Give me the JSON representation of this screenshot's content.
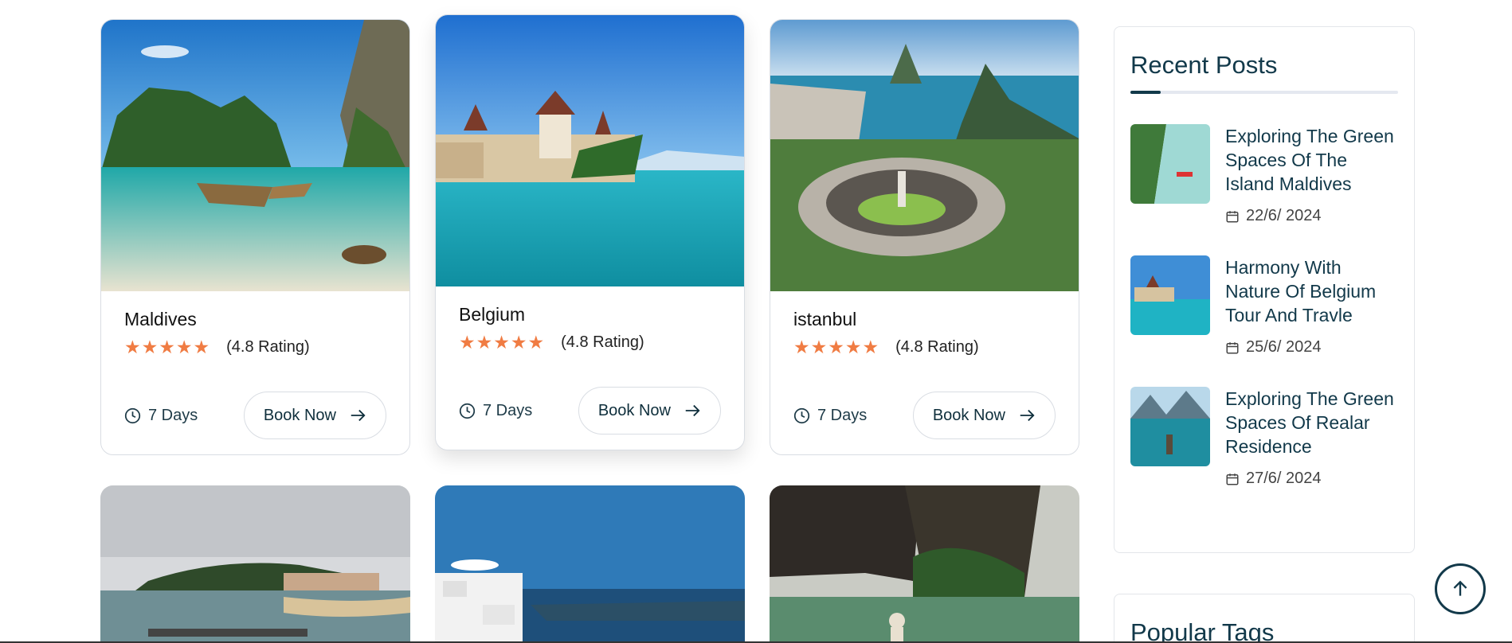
{
  "tours": [
    {
      "name": "Maldives",
      "stars": "★★★★★",
      "rating": "(4.8 Rating)",
      "days": "7 Days",
      "book": "Book Now"
    },
    {
      "name": "Belgium",
      "stars": "★★★★★",
      "rating": "(4.8 Rating)",
      "days": "7 Days",
      "book": "Book Now"
    },
    {
      "name": "istanbul",
      "stars": "★★★★★",
      "rating": "(4.8 Rating)",
      "days": "7 Days",
      "book": "Book Now"
    }
  ],
  "recent_posts": {
    "title": "Recent Posts",
    "items": [
      {
        "title": "Exploring The Green Spaces Of The Island Maldives",
        "date": "22/6/ 2024"
      },
      {
        "title": "Harmony With Nature Of Belgium Tour And Travle",
        "date": "25/6/ 2024"
      },
      {
        "title": "Exploring The Green Spaces Of Realar Residence",
        "date": "27/6/ 2024"
      }
    ]
  },
  "popular_tags": {
    "title": "Popular Tags"
  },
  "colors": {
    "accent": "#f07c43",
    "brand": "#12394a"
  },
  "icons": {
    "clock": "clock-icon",
    "arrow": "arrow-right-icon",
    "calendar": "calendar-icon",
    "scroll": "arrow-up-icon"
  }
}
